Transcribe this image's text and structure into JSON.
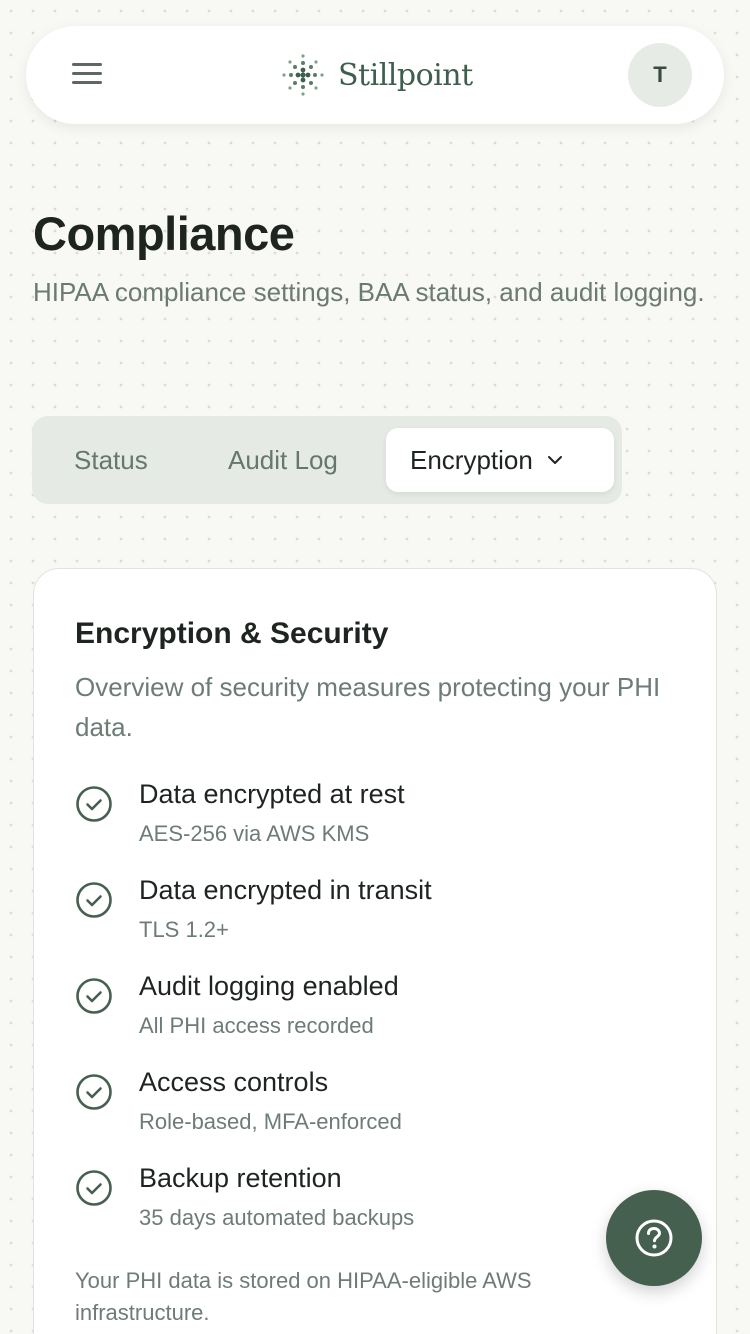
{
  "header": {
    "brand_name": "Stillpoint",
    "avatar_initial": "T"
  },
  "page": {
    "title": "Compliance",
    "subtitle": "HIPAA compliance settings, BAA status, and audit logging."
  },
  "tabs": [
    {
      "label": "Status"
    },
    {
      "label": "Audit Log"
    },
    {
      "label": "Encryption",
      "active": true
    }
  ],
  "card": {
    "title": "Encryption & Security",
    "description": "Overview of security measures protecting your PHI data.",
    "items": [
      {
        "label": "Data encrypted at rest",
        "sub": "AES-256 via AWS KMS"
      },
      {
        "label": "Data encrypted in transit",
        "sub": "TLS 1.2+"
      },
      {
        "label": "Audit logging enabled",
        "sub": "All PHI access recorded"
      },
      {
        "label": "Access controls",
        "sub": "Role-based, MFA-enforced"
      },
      {
        "label": "Backup retention",
        "sub": "35 days automated backups"
      }
    ],
    "footer": "Your PHI data is stored on HIPAA-eligible AWS infrastructure."
  },
  "icons": {
    "menu": "menu-icon",
    "logo": "dot-burst-logo",
    "check": "check-circle-icon",
    "chevron": "chevron-down-icon",
    "help": "help-icon"
  },
  "colors": {
    "brand": "#3f5f4e",
    "fab": "#46604f",
    "check": "#46604f",
    "tab_track": "#e6eae4"
  }
}
